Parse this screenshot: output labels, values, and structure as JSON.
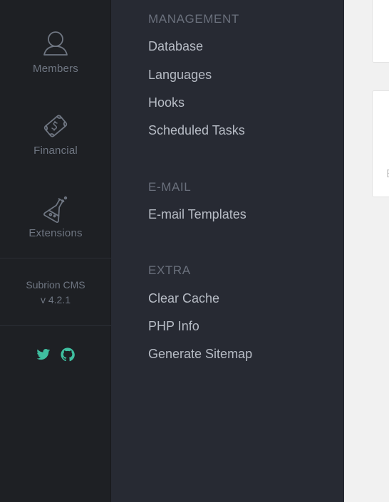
{
  "rail": {
    "items": [
      {
        "label": "Members",
        "icon": "user-icon"
      },
      {
        "label": "Financial",
        "icon": "money-icon"
      },
      {
        "label": "Extensions",
        "icon": "flask-icon"
      }
    ],
    "product": "Subrion CMS",
    "version": "v 4.2.1",
    "social": [
      {
        "icon": "twitter-icon"
      },
      {
        "icon": "github-icon"
      }
    ],
    "colors": {
      "background": "#1e2024",
      "text": "#6f7682",
      "social": "#3fbfa0"
    }
  },
  "panel": {
    "sections": [
      {
        "title": "MANAGEMENT",
        "links": [
          "Database",
          "Languages",
          "Hooks",
          "Scheduled Tasks"
        ]
      },
      {
        "title": "E-MAIL",
        "links": [
          "E-mail Templates"
        ]
      },
      {
        "title": "EXTRA",
        "links": [
          "Clear Cache",
          "PHP Info",
          "Generate Sitemap"
        ]
      }
    ],
    "colors": {
      "background": "#272a33",
      "title": "#6a707c",
      "link": "#b7bcc5"
    }
  },
  "content": {
    "card_peek": "E"
  }
}
